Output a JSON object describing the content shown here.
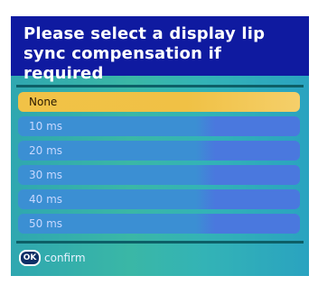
{
  "dialog": {
    "title": "Please select a display lip sync compensation if required"
  },
  "options": [
    {
      "label": "None",
      "selected": true
    },
    {
      "label": "10  ms",
      "selected": false
    },
    {
      "label": "20  ms",
      "selected": false
    },
    {
      "label": "30  ms",
      "selected": false
    },
    {
      "label": "40  ms",
      "selected": false
    },
    {
      "label": "50  ms",
      "selected": false
    }
  ],
  "footer": {
    "ok_icon": "ok-icon",
    "ok_text": "OK",
    "confirm_label": "confirm"
  },
  "colors": {
    "title_bg": "#0f1aa0",
    "panel_bg": "#33b3b6",
    "option_bg": "#3b8fd3",
    "selected_bg": "#f1c247"
  }
}
